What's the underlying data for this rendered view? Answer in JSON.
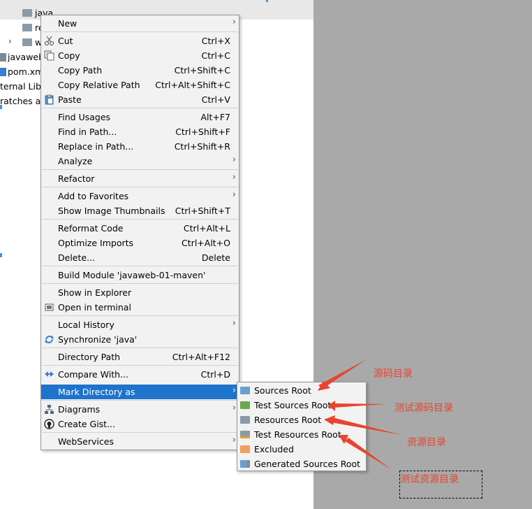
{
  "project_tree": {
    "folder_java": "java",
    "folder_resources": "re",
    "folder_webapp": "w",
    "file_iml": "javaweb",
    "file_pom": "pom.xm",
    "external_libraries": "ternal Lib",
    "scratches": "ratches ar"
  },
  "context_menu": {
    "new": "New",
    "cut": "Cut",
    "cut_sc": "Ctrl+X",
    "copy": "Copy",
    "copy_sc": "Ctrl+C",
    "copy_path": "Copy Path",
    "copy_path_sc": "Ctrl+Shift+C",
    "copy_relative_path": "Copy Relative Path",
    "copy_relative_path_sc": "Ctrl+Alt+Shift+C",
    "paste": "Paste",
    "paste_sc": "Ctrl+V",
    "find_usages": "Find Usages",
    "find_usages_sc": "Alt+F7",
    "find_in_path": "Find in Path...",
    "find_in_path_sc": "Ctrl+Shift+F",
    "replace_in_path": "Replace in Path...",
    "replace_in_path_sc": "Ctrl+Shift+R",
    "analyze": "Analyze",
    "refactor": "Refactor",
    "add_to_favorites": "Add to Favorites",
    "show_image_thumbnails": "Show Image Thumbnails",
    "show_image_thumbnails_sc": "Ctrl+Shift+T",
    "reformat_code": "Reformat Code",
    "reformat_code_sc": "Ctrl+Alt+L",
    "optimize_imports": "Optimize Imports",
    "optimize_imports_sc": "Ctrl+Alt+O",
    "delete": "Delete...",
    "delete_sc": "Delete",
    "build_module": "Build Module 'javaweb-01-maven'",
    "show_in_explorer": "Show in Explorer",
    "open_in_terminal": "Open in terminal",
    "local_history": "Local History",
    "synchronize": "Synchronize 'java'",
    "directory_path": "Directory Path",
    "directory_path_sc": "Ctrl+Alt+F12",
    "compare_with": "Compare With...",
    "compare_with_sc": "Ctrl+D",
    "mark_directory_as": "Mark Directory as",
    "diagrams": "Diagrams",
    "create_gist": "Create Gist...",
    "webservices": "WebServices"
  },
  "submenu": {
    "sources_root": "Sources Root",
    "test_sources_root": "Test Sources Root",
    "resources_root": "Resources Root",
    "test_resources_root": "Test Resources Root",
    "excluded": "Excluded",
    "generated_sources_root": "Generated Sources Root"
  },
  "annotations": {
    "sources": "源码目录",
    "test_sources": "测试源码目录",
    "resources": "资源目录",
    "test_resources": "测试资源目录"
  },
  "colors": {
    "selection": "#1e73cc",
    "annotation": "#e8442e",
    "sources_icon": "#6a9fcf",
    "test_sources_icon": "#6aa84f",
    "resources_icon": "#8a9aa8",
    "excluded_icon": "#f0a05a"
  }
}
